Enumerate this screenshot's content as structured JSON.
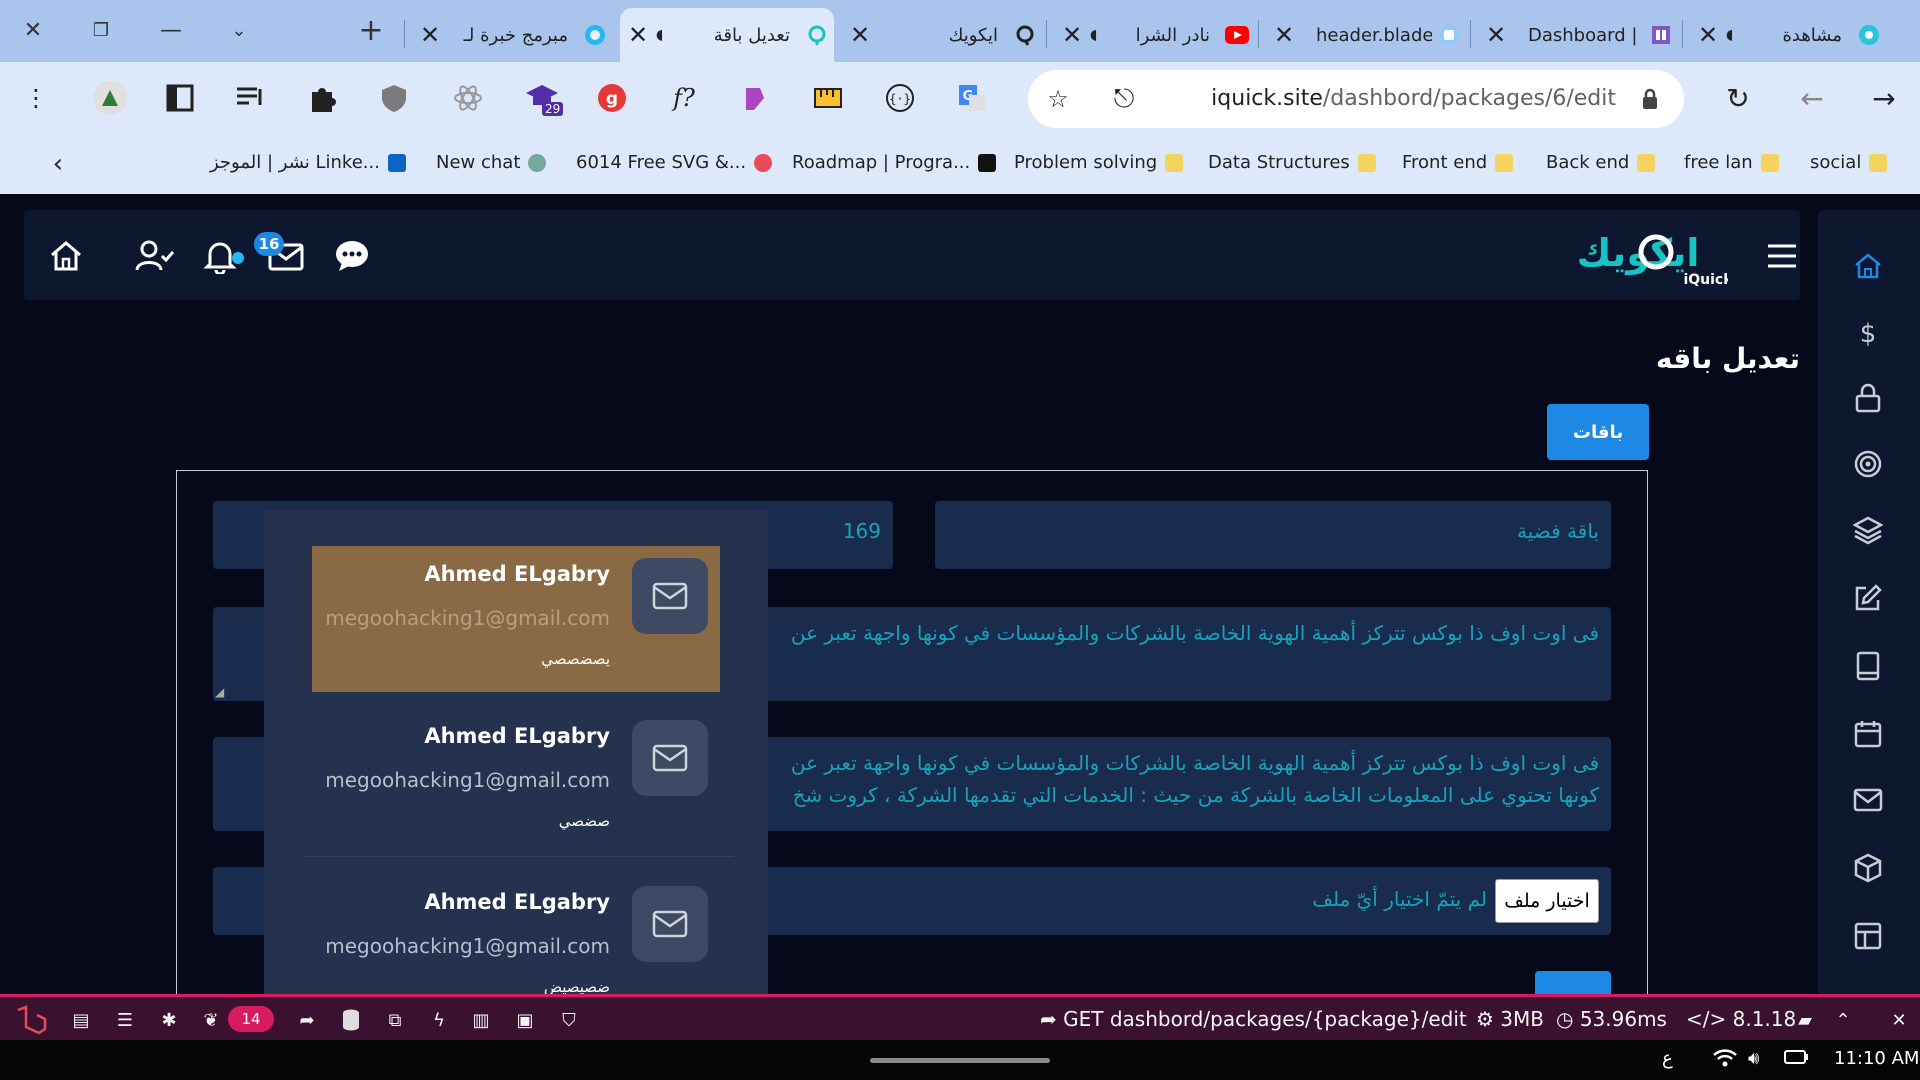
{
  "browser": {
    "tabs": [
      {
        "title": "مشاهدة",
        "favicon": "site-icon"
      },
      {
        "title": "Dashboard |",
        "favicon": "site-icon"
      },
      {
        "title": "header.blade",
        "favicon": "site-icon"
      },
      {
        "title": "نادر الشرا",
        "favicon": "youtube-icon"
      },
      {
        "title": "ايكويك",
        "favicon": "iquick-icon"
      },
      {
        "title": "تعديل باقة",
        "favicon": "iquick-icon",
        "active": true
      },
      {
        "title": "مبرمج خبرة لـ",
        "favicon": "site-icon"
      }
    ],
    "url_domain": "iquick.site",
    "url_path": "/dashbord/packages/6/edit",
    "extension_badge": "29",
    "bookmarks": [
      {
        "label": "social",
        "color": "#f4d35e"
      },
      {
        "label": "free lan",
        "color": "#f4d35e"
      },
      {
        "label": "Back end",
        "color": "#f4d35e"
      },
      {
        "label": "Front end",
        "color": "#f4d35e"
      },
      {
        "label": "Data Structures",
        "color": "#f4d35e"
      },
      {
        "label": "Problem solving",
        "color": "#f4d35e"
      },
      {
        "label": "Roadmap | Progra...",
        "color": "#111111"
      },
      {
        "label": "6014 Free SVG &...",
        "color": "#e94b5b"
      },
      {
        "label": "New chat",
        "color": "#74aa9c"
      },
      {
        "label": "نشر | الموجز Linke...",
        "color": "#0a66c2"
      }
    ]
  },
  "app": {
    "logo_arabic": "ايكويك",
    "logo_latin": "iQuick",
    "messages_count": "16",
    "page_title": "تعديل باقه",
    "packages_button": "باقات",
    "form": {
      "name_value": "باقة فضية",
      "price_value": "169",
      "description_1": "فى اوت اوف ذا بوكس تتركز أهمية الهوية الخاصة بالشركات والمؤسسات في كونها واجهة تعبر عن",
      "description_2_line1": "فى اوت اوف ذا بوكس تتركز أهمية الهوية الخاصة بالشركات والمؤسسات في كونها واجهة تعبر عن",
      "description_2_line2": "كونها تحتوي على المعلومات الخاصة بالشركة من حيث : الخدمات التي تقدمها الشركة ، كروت شخ",
      "file_button": "اختيار ملف",
      "file_status": "لم يتمّ اختيار أيّ ملف"
    },
    "messages": [
      {
        "name": "Ahmed ELgabry",
        "email": "megoohacking1@gmail.com",
        "body": "يصضصصي"
      },
      {
        "name": "Ahmed ELgabry",
        "email": "megoohacking1@gmail.com",
        "body": "صضصي"
      },
      {
        "name": "Ahmed ELgabry",
        "email": "megoohacking1@gmail.com",
        "body": "ضصيصيض"
      }
    ]
  },
  "debugbar": {
    "queries_badge": "14",
    "route": "GET dashbord/packages/{package}/edit",
    "memory": "3MB",
    "time": "53.96ms",
    "php_version": "8.1.18"
  },
  "os": {
    "keyboard": "ع",
    "clock": "11:10 AM"
  },
  "colors": {
    "accent": "#1e88e5",
    "field_text": "#17a2b8",
    "active_message": "#8a6a44",
    "debugbar": "#3a1230"
  }
}
